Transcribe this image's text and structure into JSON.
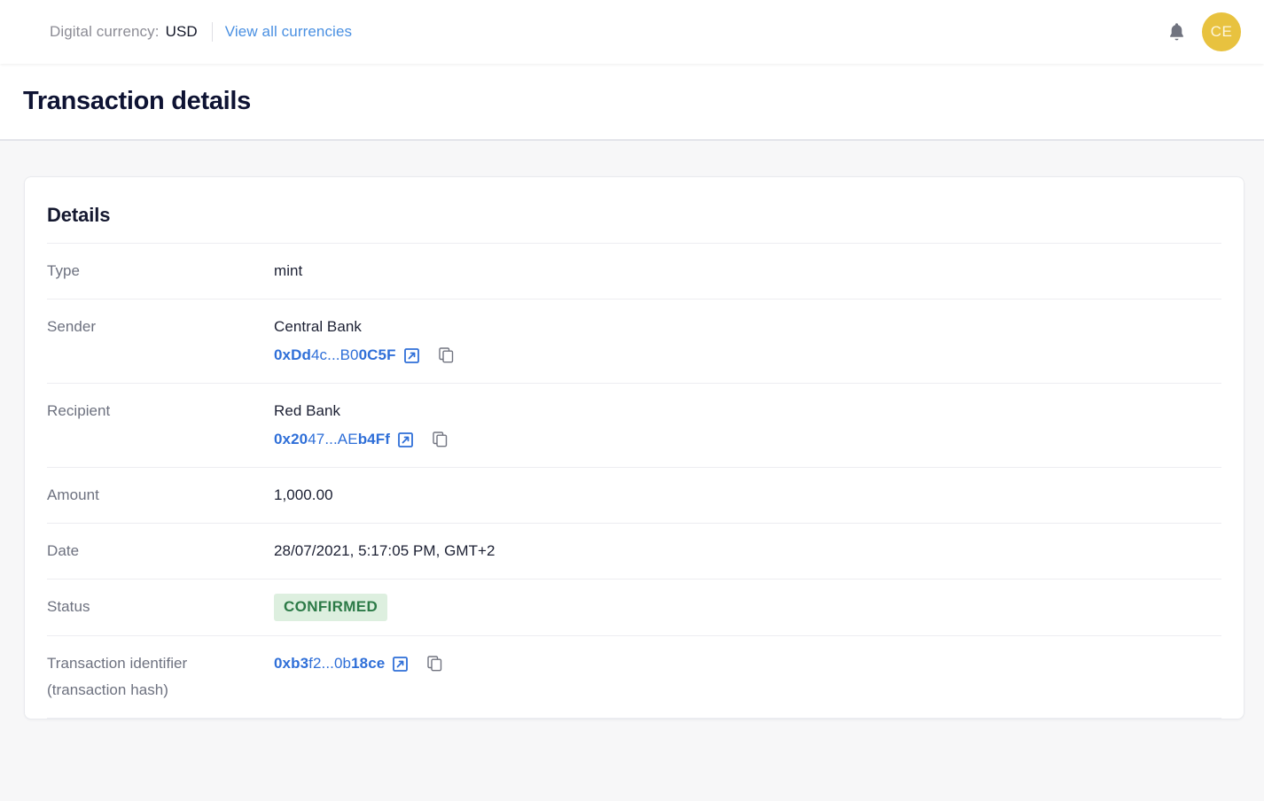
{
  "topbar": {
    "currency_label": "Digital currency:",
    "currency_value": "USD",
    "view_all_link": "View all currencies",
    "bell_icon": "bell-icon",
    "avatar_initials": "CE",
    "avatar_color": "#e8c23f"
  },
  "header": {
    "title": "Transaction details"
  },
  "card": {
    "title": "Details",
    "rows": [
      {
        "label": "Type",
        "value": "mint"
      },
      {
        "label": "Sender",
        "entity": "Central Bank",
        "address_prefix": "0xDd",
        "address_middle": "4c...B0",
        "address_suffix": "0C5F",
        "external_icon": "external-link-icon",
        "copy_icon": "copy-icon"
      },
      {
        "label": "Recipient",
        "entity": "Red Bank",
        "address_prefix": "0x20",
        "address_middle": "47...AE",
        "address_suffix": "b4Ff",
        "external_icon": "external-link-icon",
        "copy_icon": "copy-icon"
      },
      {
        "label": "Amount",
        "value": "1,000.00"
      },
      {
        "label": "Date",
        "value": "28/07/2021, 5:17:05 PM, GMT+2"
      },
      {
        "label": "Status",
        "status": "CONFIRMED",
        "status_bg": "#ddefdf",
        "status_fg": "#2c7a47"
      },
      {
        "label_line1": "Transaction identifier",
        "label_line2": "(transaction hash)",
        "address_prefix": "0xb3",
        "address_middle": "f2...0b",
        "address_suffix": "18ce",
        "external_icon": "external-link-icon",
        "copy_icon": "copy-icon"
      }
    ]
  }
}
